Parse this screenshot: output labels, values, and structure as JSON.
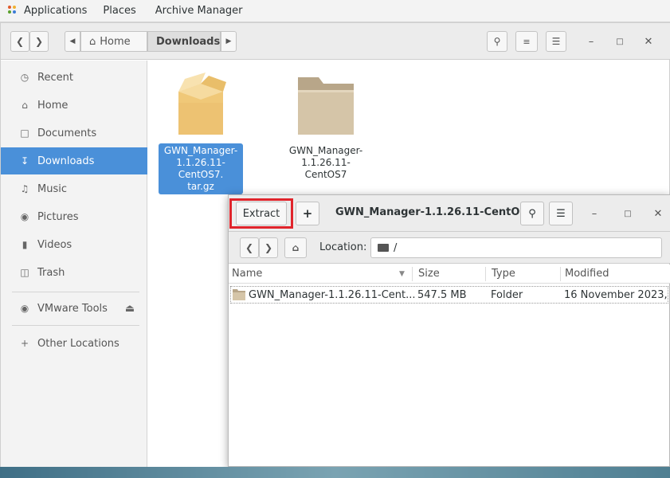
{
  "top_panel": {
    "applications": "Applications",
    "places": "Places",
    "active_app": "Archive Manager"
  },
  "files": {
    "header": {
      "home_label": "Home",
      "current_folder": "Downloads"
    },
    "sidebar": {
      "items": [
        {
          "label": "Recent",
          "icon": "clock-icon"
        },
        {
          "label": "Home",
          "icon": "home-icon"
        },
        {
          "label": "Documents",
          "icon": "document-icon"
        },
        {
          "label": "Downloads",
          "icon": "download-icon",
          "active": true
        },
        {
          "label": "Music",
          "icon": "music-icon"
        },
        {
          "label": "Pictures",
          "icon": "camera-icon"
        },
        {
          "label": "Videos",
          "icon": "video-icon"
        },
        {
          "label": "Trash",
          "icon": "trash-icon"
        }
      ],
      "devices": [
        {
          "label": "VMware Tools",
          "icon": "disc-icon"
        }
      ],
      "other_locations": "Other Locations"
    },
    "items": [
      {
        "label": "GWN_Manager-1.1.26.11-CentOS7.tar.gz",
        "line1": "GWN_Manager-",
        "line2": "1.1.26.11-CentOS7.",
        "line3": "tar.gz",
        "selected": true,
        "icon": "package-icon"
      },
      {
        "label": "GWN_Manager-1.1.26.11-CentOS7",
        "line1": "GWN_Manager-",
        "line2": "1.1.26.11-CentOS7",
        "selected": false,
        "icon": "folder-icon"
      }
    ]
  },
  "archive": {
    "extract_label": "Extract",
    "add_label": "+",
    "title": "GWN_Manager-1.1.26.11-CentO...",
    "location_label": "Location:",
    "location_value": "/",
    "columns": [
      "Name",
      "Size",
      "Type",
      "Modified"
    ],
    "rows": [
      {
        "name": "GWN_Manager-1.1.26.11-Cent...",
        "size": "547.5 MB",
        "type": "Folder",
        "modified": "16 November 2023, ..."
      }
    ]
  },
  "colors": {
    "accent": "#4a90d9",
    "highlight": "#e0242b"
  }
}
